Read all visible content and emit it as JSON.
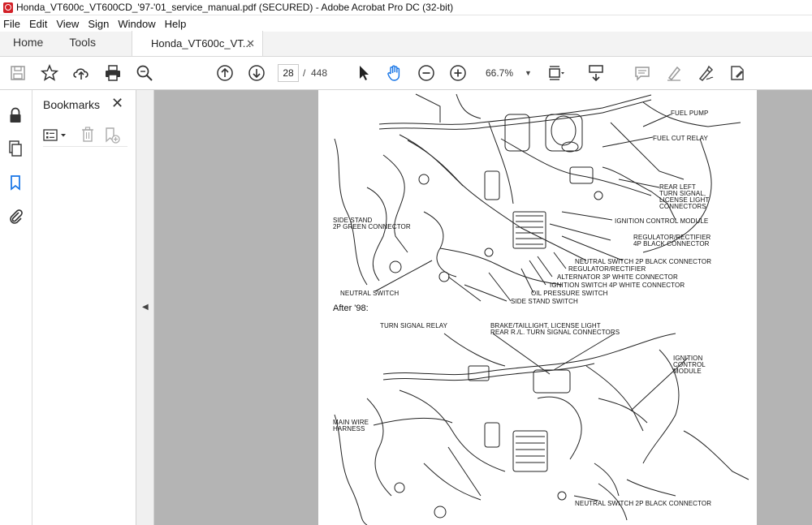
{
  "window": {
    "title": "Honda_VT600c_VT600CD_'97-'01_service_manual.pdf (SECURED) - Adobe Acrobat Pro DC (32-bit)"
  },
  "menu": [
    "File",
    "Edit",
    "View",
    "Sign",
    "Window",
    "Help"
  ],
  "tabs": {
    "home": "Home",
    "tools": "Tools",
    "document": "Honda_VT600c_VT...",
    "close": "✕"
  },
  "toolbar": {
    "page_current": "28",
    "page_sep": "/",
    "page_total": "448",
    "zoom": "66.7%"
  },
  "bookmarks": {
    "title": "Bookmarks",
    "close": "✕"
  },
  "diagram": {
    "top_labels": [
      "FUEL PUMP",
      "FUEL CUT RELAY",
      "REAR LEFT",
      "TURN SIGNAL,",
      "LICENSE LIGHT",
      "CONNECTORS",
      "IGNITION CONTROL MODULE",
      "REGULATOR/RECTIFIER",
      "4P BLACK CONNECTOR",
      "NEUTRAL SWITCH 2P BLACK CONNECTOR",
      "REGULATOR/RECTIFIER",
      "ALTERNATOR 3P WHITE CONNECTOR",
      "IGNITION SWITCH 4P WHITE CONNECTOR",
      "OIL PRESSURE SWITCH",
      "SIDE STAND SWITCH",
      "SIDE STAND",
      "2P GREEN CONNECTOR",
      "NEUTRAL SWITCH"
    ],
    "section_heading": "After '98:",
    "bottom_labels": [
      "TURN SIGNAL RELAY",
      "BRAKE/TAILLIGHT, LICENSE LIGHT",
      "REAR R./L. TURN SIGNAL CONNECTORS",
      "IGNITION",
      "CONTROL",
      "MODULE",
      "MAIN WIRE",
      "HARNESS",
      "NEUTRAL SWITCH 2P BLACK CONNECTOR"
    ]
  }
}
